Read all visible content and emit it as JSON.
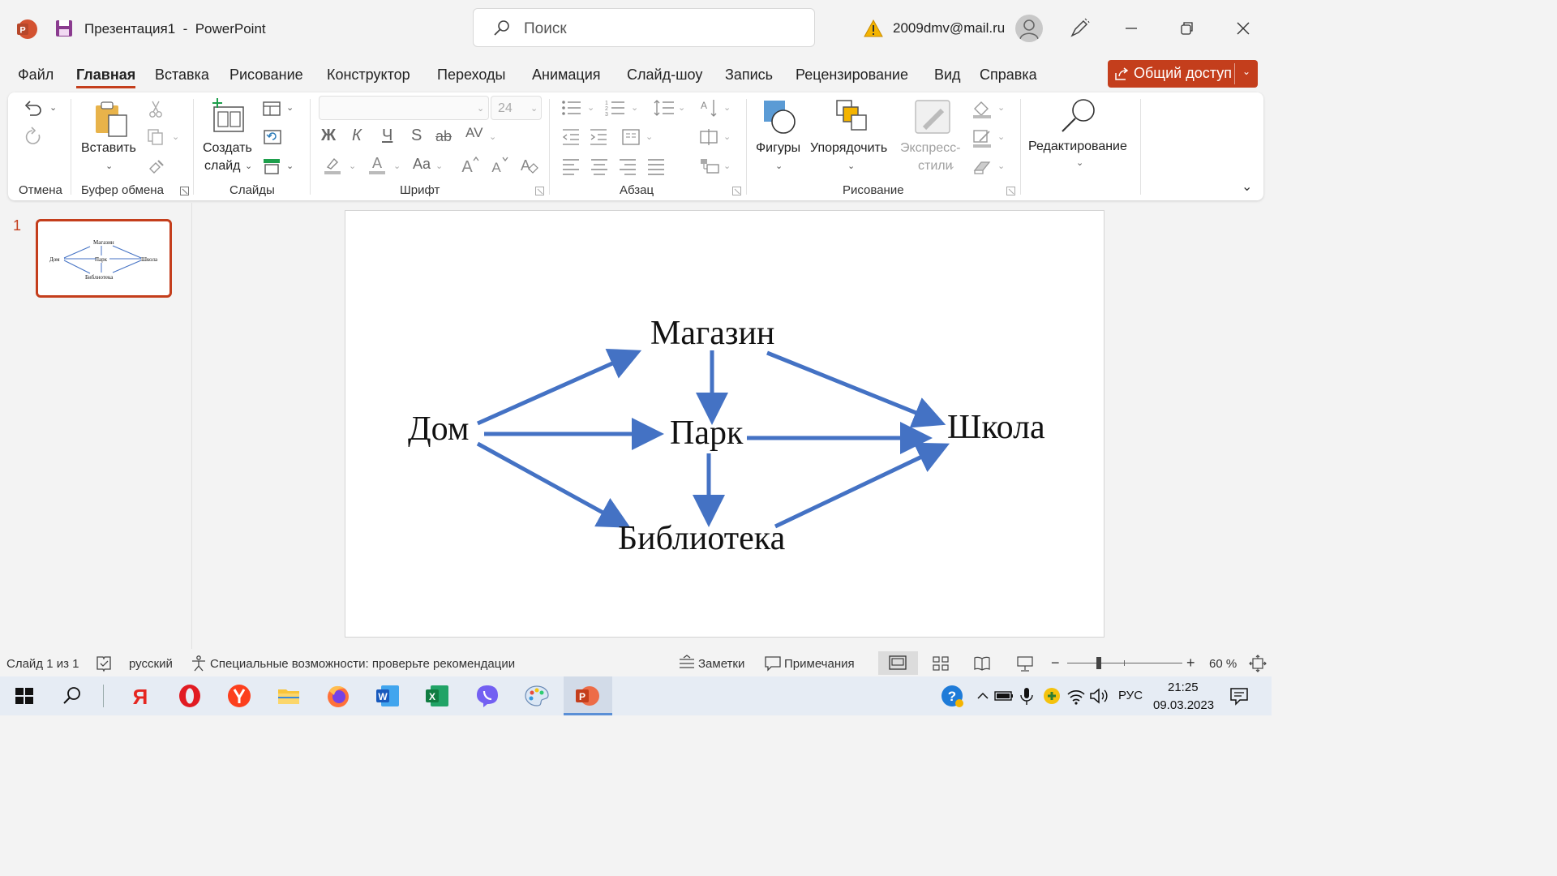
{
  "titlebar": {
    "doc_title": "Презентация1  -  PowerPoint",
    "search_placeholder": "Поиск",
    "account": "2009dmv@mail.ru"
  },
  "tabs": [
    "Файл",
    "Главная",
    "Вставка",
    "Рисование",
    "Конструктор",
    "Переходы",
    "Анимация",
    "Слайд-шоу",
    "Запись",
    "Рецензирование",
    "Вид",
    "Справка"
  ],
  "active_tab": "Главная",
  "share_label": "Общий доступ",
  "ribbon": {
    "groups": {
      "undo": "Отмена",
      "clipboard": "Буфер обмена",
      "slides": "Слайды",
      "font": "Шрифт",
      "paragraph": "Абзац",
      "drawing": "Рисование"
    },
    "paste_label": "Вставить",
    "new_slide_line1": "Создать",
    "new_slide_line2": "слайд",
    "font_size": "24",
    "shapes_label": "Фигуры",
    "arrange_label": "Упорядочить",
    "quick_styles_line1": "Экспресс-",
    "quick_styles_line2": "стили",
    "editing_label": "Редактирование",
    "bold": "Ж",
    "italic": "К",
    "underline": "Ч",
    "strike": "S",
    "strike2": "ab",
    "spacing": "AV",
    "case": "Aa"
  },
  "slide_panel": {
    "slide_number": "1"
  },
  "diagram": {
    "nodes": {
      "home": "Дом",
      "shop": "Магазин",
      "park": "Парк",
      "school": "Школа",
      "library": "Библиотека"
    },
    "edges": [
      [
        "Дом",
        "Магазин"
      ],
      [
        "Дом",
        "Парк"
      ],
      [
        "Дом",
        "Библиотека"
      ],
      [
        "Магазин",
        "Парк"
      ],
      [
        "Магазин",
        "Школа"
      ],
      [
        "Парк",
        "Школа"
      ],
      [
        "Парк",
        "Библиотека"
      ],
      [
        "Библиотека",
        "Школа"
      ]
    ],
    "arrow_color": "#4472c4"
  },
  "statusbar": {
    "slide_info": "Слайд 1 из 1",
    "language": "русский",
    "accessibility": "Специальные возможности: проверьте рекомендации",
    "notes": "Заметки",
    "comments": "Примечания",
    "zoom": "60 %"
  },
  "taskbar": {
    "lang": "РУС",
    "time": "21:25",
    "date": "09.03.2023"
  },
  "colors": {
    "accent": "#c43e1c"
  }
}
